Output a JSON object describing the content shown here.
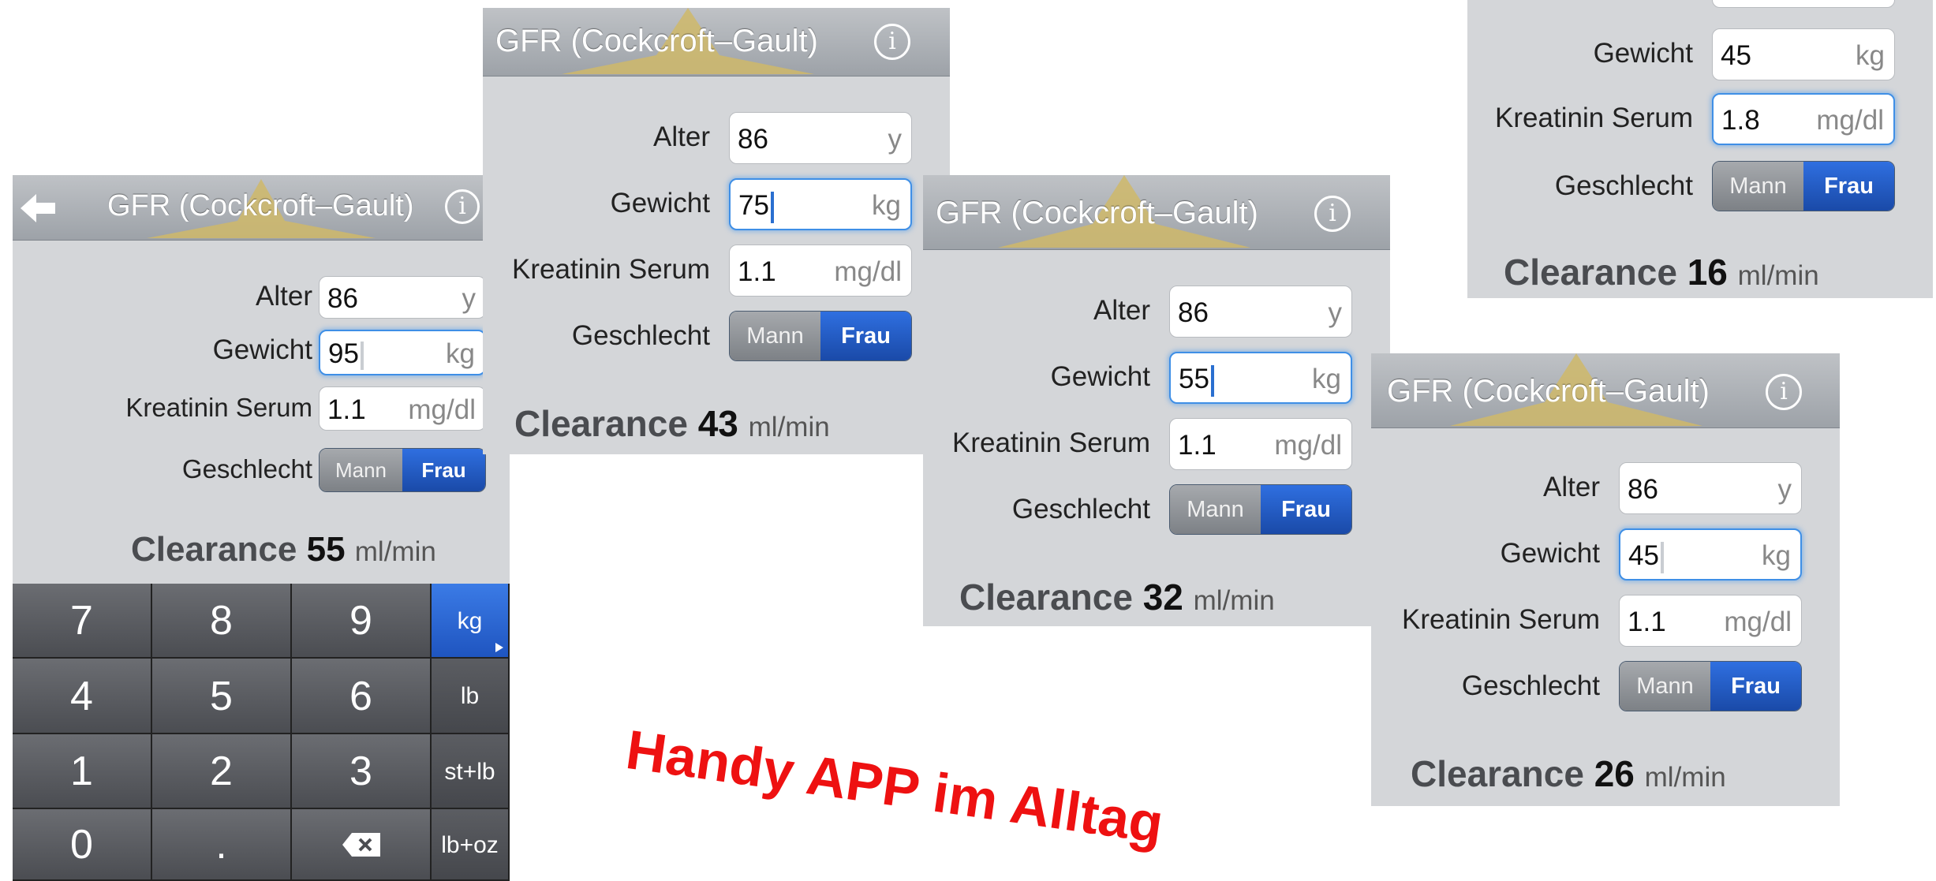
{
  "app": {
    "title": "GFR (Cockcroft–Gault)",
    "info_glyph": "i",
    "labels": {
      "alter": "Alter",
      "gewicht": "Gewicht",
      "kreatinin": "Kreatinin Serum",
      "geschlecht": "Geschlecht",
      "clearance": "Clearance"
    },
    "units": {
      "age": "y",
      "weight": "kg",
      "creatinine": "mg/dl",
      "clearance": "ml/min"
    },
    "sex_options": {
      "male": "Mann",
      "female": "Frau"
    },
    "selected_sex": "Frau"
  },
  "screens": [
    {
      "id": "a",
      "alter": "86",
      "gewicht": "95",
      "kreatinin": "1.1",
      "clearance": "55",
      "has_back": true
    },
    {
      "id": "b",
      "alter": "86",
      "gewicht": "75",
      "kreatinin": "1.1",
      "clearance": "43",
      "has_back": false
    },
    {
      "id": "c",
      "alter": "86",
      "gewicht": "55",
      "kreatinin": "1.1",
      "clearance": "32",
      "has_back": false
    },
    {
      "id": "d",
      "alter": "86",
      "gewicht": "45",
      "kreatinin": "1.1",
      "clearance": "26",
      "has_back": false
    },
    {
      "id": "e",
      "gewicht": "45",
      "kreatinin": "1.8",
      "clearance": "16",
      "has_back": false
    }
  ],
  "keypad": {
    "keys": [
      [
        "7",
        "8",
        "9",
        "kg"
      ],
      [
        "4",
        "5",
        "6",
        "lb"
      ],
      [
        "1",
        "2",
        "3",
        "st+lb"
      ],
      [
        "0",
        ".",
        "⌫",
        "lb+oz"
      ]
    ],
    "active_unit": "kg",
    "delete_icon": "backspace-icon"
  },
  "colors": {
    "accent": "#2a5fc7",
    "navbar": "#a9adb2",
    "background": "#d4d6d9",
    "caption": "#ee1111"
  },
  "caption": "Handy APP im Alltag"
}
